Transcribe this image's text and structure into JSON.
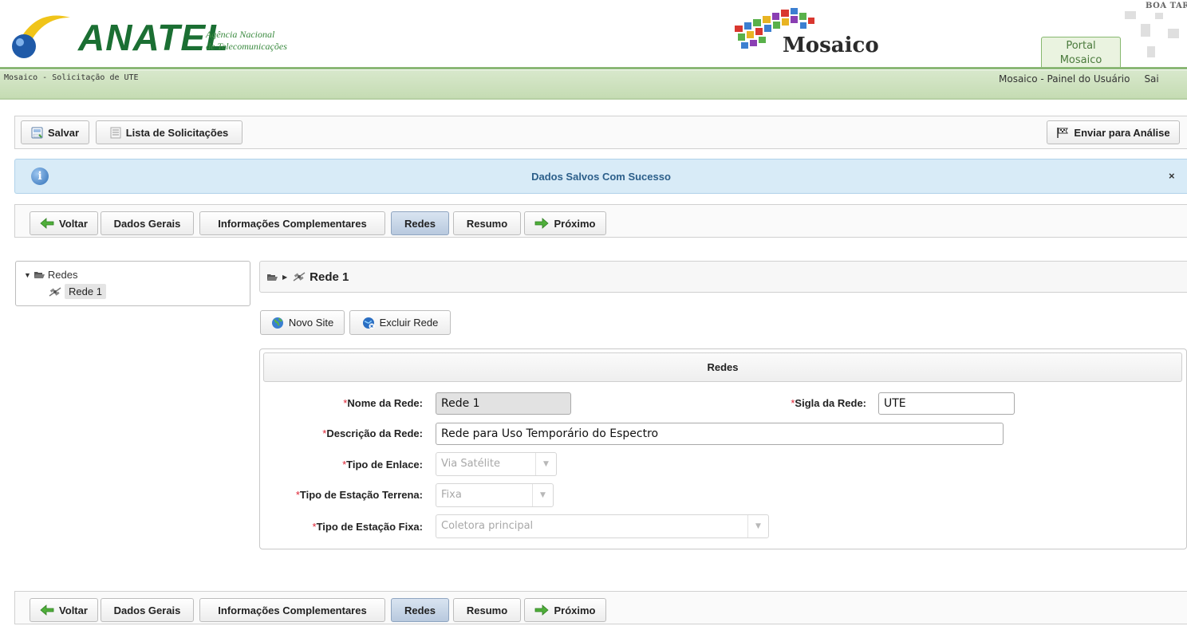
{
  "header": {
    "brand": "ANATEL",
    "brand_subtitle_line1": "Agência Nacional",
    "brand_subtitle_line2": "de Telecomunicações",
    "app_logo_text": "Mosaico",
    "greeting": "BOA TARD",
    "portal_tab_line1": "Portal",
    "portal_tab_line2": "Mosaico"
  },
  "subbar": {
    "page_title": "Mosaico - Solicitação de UTE",
    "user_panel_link": "Mosaico - Painel do Usuário",
    "logout_link": "Sai"
  },
  "toolbar": {
    "save_label": "Salvar",
    "list_label": "Lista de Solicitações",
    "send_label": "Enviar para Análise"
  },
  "message": {
    "text": "Dados Salvos Com Sucesso",
    "close": "×"
  },
  "nav": {
    "back": "Voltar",
    "general": "Dados Gerais",
    "complementary": "Informações Complementares",
    "networks": "Redes",
    "summary": "Resumo",
    "next": "Próximo",
    "active": "Redes"
  },
  "tree": {
    "root_label": "Redes",
    "child_label": "Rede 1"
  },
  "breadcrumb": {
    "current": "Rede 1"
  },
  "actions": {
    "new_site": "Novo Site",
    "delete_network": "Excluir Rede"
  },
  "form": {
    "title": "Redes",
    "required_mark": "*",
    "fields": {
      "network_name": {
        "label": "Nome da Rede:",
        "value": "Rede 1"
      },
      "network_acronym": {
        "label": "Sigla da Rede:",
        "value": "UTE"
      },
      "network_description": {
        "label": "Descrição da Rede:",
        "value": "Rede para Uso Temporário do Espectro"
      },
      "link_type": {
        "label": "Tipo de Enlace:",
        "value": "Via Satélite"
      },
      "earth_station_type": {
        "label": "Tipo de Estação Terrena:",
        "value": "Fixa"
      },
      "fixed_station_type": {
        "label": "Tipo de Estação Fixa:",
        "value": "Coletora principal"
      }
    }
  },
  "colors": {
    "brand_green": "#1b6f33",
    "subbar_green": "#c5dcb3",
    "info_blue": "#d8ebf7",
    "active_tab": "#b8c9de",
    "required_red": "#d23"
  },
  "icons": [
    "save-icon",
    "list-icon",
    "flag-icon",
    "info-icon",
    "close-icon",
    "arrow-left-icon",
    "arrow-right-icon",
    "folder-open-icon",
    "expand-arrow-icon",
    "satellite-icon",
    "globe-icon",
    "globe-delete-icon",
    "dropdown-arrow-icon"
  ]
}
